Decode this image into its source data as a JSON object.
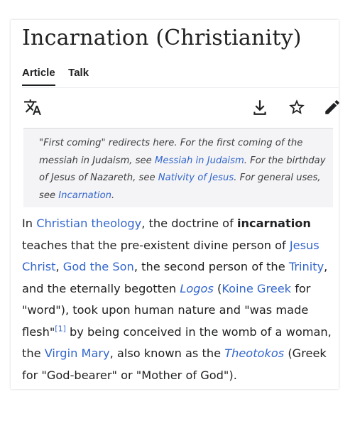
{
  "page": {
    "title": "Incarnation (Christianity)"
  },
  "tabs": [
    {
      "label": "Article",
      "active": true
    },
    {
      "label": "Talk",
      "active": false
    }
  ],
  "toolbar": {
    "icons": [
      "translate-icon",
      "download-icon",
      "star-icon",
      "edit-pencil-icon"
    ]
  },
  "hatnote": {
    "part1": "\"First coming\" redirects here. For the first coming of the messiah in Judaism, see ",
    "link1": "Messiah in Judaism",
    "part2": ". For the birthday of Jesus of Nazareth, see ",
    "link2": "Nativity of Jesus",
    "part3": ". For general uses, see ",
    "link3": "Incarnation",
    "part4": "."
  },
  "body": {
    "t1": "In ",
    "l_christian_theology": "Christian theology",
    "t2": ", the doctrine of ",
    "b_incarnation": "incarnation",
    "t3": " teaches that the pre-existent divine person of ",
    "l_jesus_christ": "Jesus Christ",
    "t4": ", ",
    "l_god_the_son": "God the Son",
    "t5": ", the second person of the ",
    "l_trinity": "Trinity",
    "t6": ", and the eternally begotten ",
    "l_logos": "Logos",
    "t7": " (",
    "l_koine_greek": "Koine Greek",
    "t8": " for \"word\"), took upon human nature and \"was made flesh\"",
    "ref1": "[1]",
    "t9": " by being conceived in the womb of a woman, the ",
    "l_virgin_mary": "Virgin Mary",
    "t10": ", also known as the ",
    "l_theotokos": "Theotokos",
    "t11": " (Greek for \"God-bearer\" or \"Mother of God\")."
  },
  "colors": {
    "link": "#3366cc",
    "text": "#202122",
    "hatnote_bg": "#f4f4f6"
  }
}
